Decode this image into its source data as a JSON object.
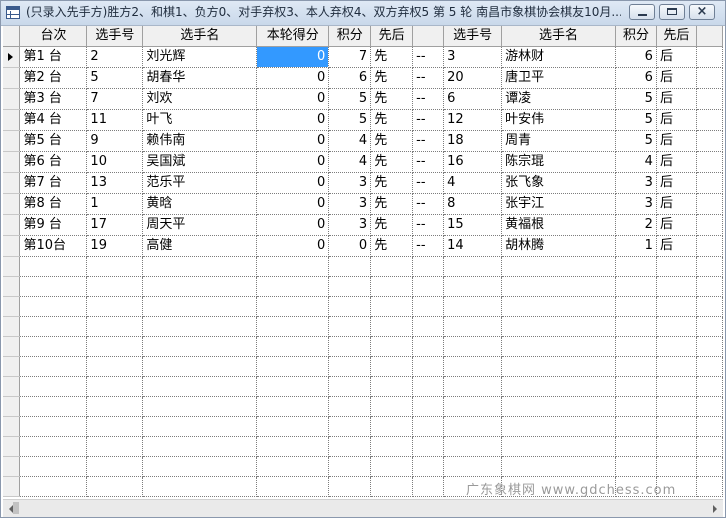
{
  "window": {
    "title": "(只录入先手方)胜方2、和棋1、负方0、对手弃权3、本人弃权4、双方弃权5  第 5 轮  南昌市象棋协会棋友10月..."
  },
  "table": {
    "headers": [
      "台次",
      "选手号",
      "选手名",
      "本轮得分",
      "积分",
      "先后",
      "",
      "选手号",
      "选手名",
      "积分",
      "先后"
    ],
    "rows": [
      [
        "第1  台",
        "2",
        "刘光辉",
        "0",
        "7",
        "先",
        "--",
        "3",
        "游林财",
        "6",
        "后"
      ],
      [
        "第2  台",
        "5",
        "胡春华",
        "0",
        "6",
        "先",
        "--",
        "20",
        "唐卫平",
        "6",
        "后"
      ],
      [
        "第3  台",
        "7",
        "刘欢",
        "0",
        "5",
        "先",
        "--",
        "6",
        "谭凌",
        "5",
        "后"
      ],
      [
        "第4  台",
        "11",
        "叶飞",
        "0",
        "5",
        "先",
        "--",
        "12",
        "叶安伟",
        "5",
        "后"
      ],
      [
        "第5  台",
        "9",
        "赖伟南",
        "0",
        "4",
        "先",
        "--",
        "18",
        "周青",
        "5",
        "后"
      ],
      [
        "第6  台",
        "10",
        "吴国斌",
        "0",
        "4",
        "先",
        "--",
        "16",
        "陈宗琨",
        "4",
        "后"
      ],
      [
        "第7  台",
        "13",
        "范乐平",
        "0",
        "3",
        "先",
        "--",
        "4",
        "张飞象",
        "3",
        "后"
      ],
      [
        "第8  台",
        "1",
        "黄晗",
        "0",
        "3",
        "先",
        "--",
        "8",
        "张宇江",
        "3",
        "后"
      ],
      [
        "第9  台",
        "17",
        "周天平",
        "0",
        "3",
        "先",
        "--",
        "15",
        "黄福根",
        "2",
        "后"
      ],
      [
        "第10台",
        "19",
        "高健",
        "0",
        "0",
        "先",
        "--",
        "14",
        "胡林腾",
        "1",
        "后"
      ]
    ],
    "empty_rows": 12
  },
  "watermark": "广东象棋网  www.gdchess.com"
}
